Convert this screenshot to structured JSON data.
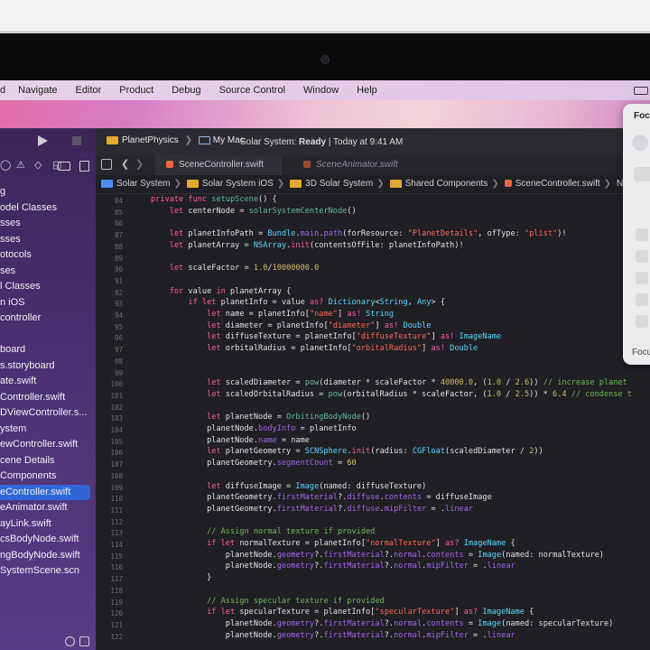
{
  "menubar": {
    "items": [
      "d",
      "Navigate",
      "Editor",
      "Product",
      "Debug",
      "Source Control",
      "Window",
      "Help"
    ]
  },
  "sidebar": {
    "items": [
      {
        "label": "g",
        "selected": false
      },
      {
        "label": "odel Classes",
        "selected": false
      },
      {
        "label": "sses",
        "selected": false
      },
      {
        "label": "sses",
        "selected": false
      },
      {
        "label": "otocols",
        "selected": false
      },
      {
        "label": "ses",
        "selected": false
      },
      {
        "label": "l Classes",
        "selected": false
      },
      {
        "label": "n iOS",
        "selected": false
      },
      {
        "label": "controller",
        "selected": false
      },
      {
        "label": "",
        "selected": false
      },
      {
        "label": "board",
        "selected": false
      },
      {
        "label": "s.storyboard",
        "selected": false
      },
      {
        "label": "ate.swift",
        "selected": false
      },
      {
        "label": "Controller.swift",
        "selected": false
      },
      {
        "label": "DViewController.s...",
        "selected": false
      },
      {
        "label": "ystem",
        "selected": false
      },
      {
        "label": "ewController.swift",
        "selected": false
      },
      {
        "label": "cene Details",
        "selected": false
      },
      {
        "label": "Components",
        "selected": false
      },
      {
        "label": "eController.swift",
        "selected": true
      },
      {
        "label": "eAnimator.swift",
        "selected": false
      },
      {
        "label": "ayLink.swift",
        "selected": false
      },
      {
        "label": "csBodyNode.swift",
        "selected": false
      },
      {
        "label": "ngBodyNode.swift",
        "selected": false
      },
      {
        "label": "SystemScene.scn",
        "selected": false
      }
    ]
  },
  "toolbar": {
    "project": "PlanetPhysics",
    "destination": "My Mac",
    "status_prefix": "Solar System: ",
    "status_state": "Ready",
    "status_suffix": " | Today at 9:41 AM"
  },
  "tabs": {
    "active": "SceneController.swift",
    "inactive": "SceneAnimator.swift"
  },
  "breadcrumb": [
    "Solar System",
    "Solar System iOS",
    "3D Solar System",
    "Shared Components",
    "SceneController.swift",
    "No Selection"
  ],
  "code": {
    "line_numbers": [
      "84",
      "85",
      "86",
      "87",
      "88",
      "89",
      "90",
      "91",
      "92",
      "93",
      "94",
      "95",
      "96",
      "97",
      "98",
      "99",
      "100",
      "101",
      "102",
      "103",
      "104",
      "105",
      "106",
      "107",
      "108",
      "109",
      "110",
      "111",
      "112",
      "113",
      "114",
      "115",
      "116",
      "117",
      "118",
      "119",
      "120",
      "121",
      "122"
    ],
    "lines": [
      [
        [
          "kw",
          "private "
        ],
        [
          "kw",
          "func "
        ],
        [
          "fn",
          "setupScene"
        ],
        [
          "",
          "() {"
        ]
      ],
      [
        [
          "",
          "    "
        ],
        [
          "kw",
          "let "
        ],
        [
          "",
          "centerNode = "
        ],
        [
          "fn",
          "solarSystemCenterNode"
        ],
        [
          "",
          "()"
        ]
      ],
      [],
      [
        [
          "",
          "    "
        ],
        [
          "kw",
          "let "
        ],
        [
          "",
          "planetInfoPath = "
        ],
        [
          "ty",
          "Bundle"
        ],
        [
          "",
          "."
        ],
        [
          "pr",
          "main"
        ],
        [
          "",
          "."
        ],
        [
          "pr",
          "path"
        ],
        [
          "",
          "(forResource: "
        ],
        [
          "st",
          "\"PlanetDetails\""
        ],
        [
          "",
          ", ofType: "
        ],
        [
          "st",
          "\"plist\""
        ],
        [
          "",
          ")!"
        ]
      ],
      [
        [
          "",
          "    "
        ],
        [
          "kw",
          "let "
        ],
        [
          "",
          "planetArray = "
        ],
        [
          "ty",
          "NSArray"
        ],
        [
          "",
          "."
        ],
        [
          "kw",
          "init"
        ],
        [
          "",
          "(contentsOfFile: planetInfoPath)!"
        ]
      ],
      [],
      [
        [
          "",
          "    "
        ],
        [
          "kw",
          "let "
        ],
        [
          "",
          "scaleFactor = "
        ],
        [
          "nu",
          "1.0"
        ],
        [
          "",
          "/"
        ],
        [
          "nu",
          "10000000.0"
        ]
      ],
      [],
      [
        [
          "",
          "    "
        ],
        [
          "kw",
          "for "
        ],
        [
          "",
          "value "
        ],
        [
          "kw",
          "in "
        ],
        [
          "",
          "planetArray {"
        ]
      ],
      [
        [
          "",
          "        "
        ],
        [
          "kw",
          "if let "
        ],
        [
          "",
          "planetInfo = value "
        ],
        [
          "kw",
          "as? "
        ],
        [
          "ty",
          "Dictionary"
        ],
        [
          "",
          "<"
        ],
        [
          "ty",
          "String"
        ],
        [
          "",
          ", "
        ],
        [
          "ty",
          "Any"
        ],
        [
          "",
          "> {"
        ]
      ],
      [
        [
          "",
          "            "
        ],
        [
          "kw",
          "let "
        ],
        [
          "",
          "name = planetInfo["
        ],
        [
          "st",
          "\"name\""
        ],
        [
          "",
          "] "
        ],
        [
          "kw",
          "as! "
        ],
        [
          "ty",
          "String"
        ]
      ],
      [
        [
          "",
          "            "
        ],
        [
          "kw",
          "let "
        ],
        [
          "",
          "diameter = planetInfo["
        ],
        [
          "st",
          "\"diameter\""
        ],
        [
          "",
          "] "
        ],
        [
          "kw",
          "as! "
        ],
        [
          "ty",
          "Double"
        ]
      ],
      [
        [
          "",
          "            "
        ],
        [
          "kw",
          "let "
        ],
        [
          "",
          "diffuseTexture = planetInfo["
        ],
        [
          "st",
          "\"diffuseTexture\""
        ],
        [
          "",
          "] "
        ],
        [
          "kw",
          "as! "
        ],
        [
          "ty",
          "ImageName"
        ]
      ],
      [
        [
          "",
          "            "
        ],
        [
          "kw",
          "let "
        ],
        [
          "",
          "orbitalRadius = planetInfo["
        ],
        [
          "st",
          "\"orbitalRadius\""
        ],
        [
          "",
          "] "
        ],
        [
          "kw",
          "as! "
        ],
        [
          "ty",
          "Double"
        ]
      ],
      [],
      [],
      [
        [
          "",
          "            "
        ],
        [
          "kw",
          "let "
        ],
        [
          "",
          "scaledDiameter = "
        ],
        [
          "fn",
          "pow"
        ],
        [
          "",
          "(diameter * scaleFactor * "
        ],
        [
          "nu",
          "40000.0"
        ],
        [
          "",
          ", ("
        ],
        [
          "nu",
          "1.0"
        ],
        [
          "",
          " / "
        ],
        [
          "nu",
          "2.6"
        ],
        [
          "",
          "))"
        ],
        [
          "cm",
          " // increase planet"
        ]
      ],
      [
        [
          "",
          "            "
        ],
        [
          "kw",
          "let "
        ],
        [
          "",
          "scaledOrbitalRadius = "
        ],
        [
          "fn",
          "pow"
        ],
        [
          "",
          "(orbitalRadius * scaleFactor, ("
        ],
        [
          "nu",
          "1.0"
        ],
        [
          "",
          " / "
        ],
        [
          "nu",
          "2.5"
        ],
        [
          "",
          ")) * "
        ],
        [
          "nu",
          "6.4"
        ],
        [
          "cm",
          " // condense t"
        ]
      ],
      [],
      [
        [
          "",
          "            "
        ],
        [
          "kw",
          "let "
        ],
        [
          "",
          "planetNode = "
        ],
        [
          "fn",
          "OrbitingBodyNode"
        ],
        [
          "",
          "()"
        ]
      ],
      [
        [
          "",
          "            "
        ],
        [
          "",
          "planetNode."
        ],
        [
          "pr",
          "bodyInfo"
        ],
        [
          "",
          " = planetInfo"
        ]
      ],
      [
        [
          "",
          "            "
        ],
        [
          "",
          "planetNode."
        ],
        [
          "pr",
          "name"
        ],
        [
          "",
          " = name"
        ]
      ],
      [
        [
          "",
          "            "
        ],
        [
          "kw",
          "let "
        ],
        [
          "",
          "planetGeometry = "
        ],
        [
          "ty",
          "SCNSphere"
        ],
        [
          "",
          "."
        ],
        [
          "kw",
          "init"
        ],
        [
          "",
          "(radius: "
        ],
        [
          "ty",
          "CGFloat"
        ],
        [
          "",
          "(scaledDiameter / "
        ],
        [
          "nu",
          "2"
        ],
        [
          "",
          "))"
        ]
      ],
      [
        [
          "",
          "            "
        ],
        [
          "",
          "planetGeometry."
        ],
        [
          "pr",
          "segmentCount"
        ],
        [
          "",
          " = "
        ],
        [
          "nu",
          "60"
        ]
      ],
      [],
      [
        [
          "",
          "            "
        ],
        [
          "kw",
          "let "
        ],
        [
          "",
          "diffuseImage = "
        ],
        [
          "ty",
          "Image"
        ],
        [
          "",
          "(named: diffuseTexture)"
        ]
      ],
      [
        [
          "",
          "            "
        ],
        [
          "",
          "planetGeometry."
        ],
        [
          "pr",
          "firstMaterial"
        ],
        [
          "",
          "?."
        ],
        [
          "pr",
          "diffuse"
        ],
        [
          "",
          "."
        ],
        [
          "pr",
          "contents"
        ],
        [
          "",
          " = diffuseImage"
        ]
      ],
      [
        [
          "",
          "            "
        ],
        [
          "",
          "planetGeometry."
        ],
        [
          "pr",
          "firstMaterial"
        ],
        [
          "",
          "?."
        ],
        [
          "pr",
          "diffuse"
        ],
        [
          "",
          "."
        ],
        [
          "pr",
          "mipFilter"
        ],
        [
          "",
          " = ."
        ],
        [
          "pr",
          "linear"
        ]
      ],
      [],
      [
        [
          "",
          "            "
        ],
        [
          "cm",
          "// Assign normal texture if provided"
        ]
      ],
      [
        [
          "",
          "            "
        ],
        [
          "kw",
          "if let "
        ],
        [
          "",
          "normalTexture = planetInfo["
        ],
        [
          "st",
          "\"normalTexture\""
        ],
        [
          "",
          "] "
        ],
        [
          "kw",
          "as? "
        ],
        [
          "ty",
          "ImageName"
        ],
        [
          "",
          " {"
        ]
      ],
      [
        [
          "",
          "                "
        ],
        [
          "",
          "planetNode."
        ],
        [
          "pr",
          "geometry"
        ],
        [
          "",
          "?."
        ],
        [
          "pr",
          "firstMaterial"
        ],
        [
          "",
          "?."
        ],
        [
          "pr",
          "normal"
        ],
        [
          "",
          "."
        ],
        [
          "pr",
          "contents"
        ],
        [
          "",
          " = "
        ],
        [
          "ty",
          "Image"
        ],
        [
          "",
          "(named: normalTexture)"
        ]
      ],
      [
        [
          "",
          "                "
        ],
        [
          "",
          "planetNode."
        ],
        [
          "pr",
          "geometry"
        ],
        [
          "",
          "?."
        ],
        [
          "pr",
          "firstMaterial"
        ],
        [
          "",
          "?."
        ],
        [
          "pr",
          "normal"
        ],
        [
          "",
          "."
        ],
        [
          "pr",
          "mipFilter"
        ],
        [
          "",
          " = ."
        ],
        [
          "pr",
          "linear"
        ]
      ],
      [
        [
          "",
          "            "
        ],
        [
          "",
          "}"
        ]
      ],
      [],
      [
        [
          "",
          "            "
        ],
        [
          "cm",
          "// Assign specular texture if provided"
        ]
      ],
      [
        [
          "",
          "            "
        ],
        [
          "kw",
          "if let "
        ],
        [
          "",
          "specularTexture = planetInfo["
        ],
        [
          "st",
          "\"specularTexture\""
        ],
        [
          "",
          "] "
        ],
        [
          "kw",
          "as? "
        ],
        [
          "ty",
          "ImageName"
        ],
        [
          "",
          " {"
        ]
      ],
      [
        [
          "",
          "                "
        ],
        [
          "",
          "planetNode."
        ],
        [
          "pr",
          "geometry"
        ],
        [
          "",
          "?."
        ],
        [
          "pr",
          "firstMaterial"
        ],
        [
          "",
          "?."
        ],
        [
          "pr",
          "normal"
        ],
        [
          "",
          "."
        ],
        [
          "pr",
          "contents"
        ],
        [
          "",
          " = "
        ],
        [
          "ty",
          "Image"
        ],
        [
          "",
          "(named: specularTexture)"
        ]
      ],
      [
        [
          "",
          "                "
        ],
        [
          "",
          "planetNode."
        ],
        [
          "pr",
          "geometry"
        ],
        [
          "",
          "?."
        ],
        [
          "pr",
          "firstMaterial"
        ],
        [
          "",
          "?."
        ],
        [
          "pr",
          "normal"
        ],
        [
          "",
          "."
        ],
        [
          "pr",
          "mipFilter"
        ],
        [
          "",
          " = ."
        ],
        [
          "pr",
          "linear"
        ]
      ]
    ]
  },
  "focus_panel": {
    "title": "Foc",
    "footer": "Focu"
  },
  "icons": {
    "run": "play-icon",
    "stop": "stop-icon",
    "scheme": "folder-icon",
    "destination": "mac-icon",
    "grid": "grid-icon",
    "back": "chevron-left-icon",
    "forward": "chevron-right-icon",
    "focus": "moon-icon"
  }
}
